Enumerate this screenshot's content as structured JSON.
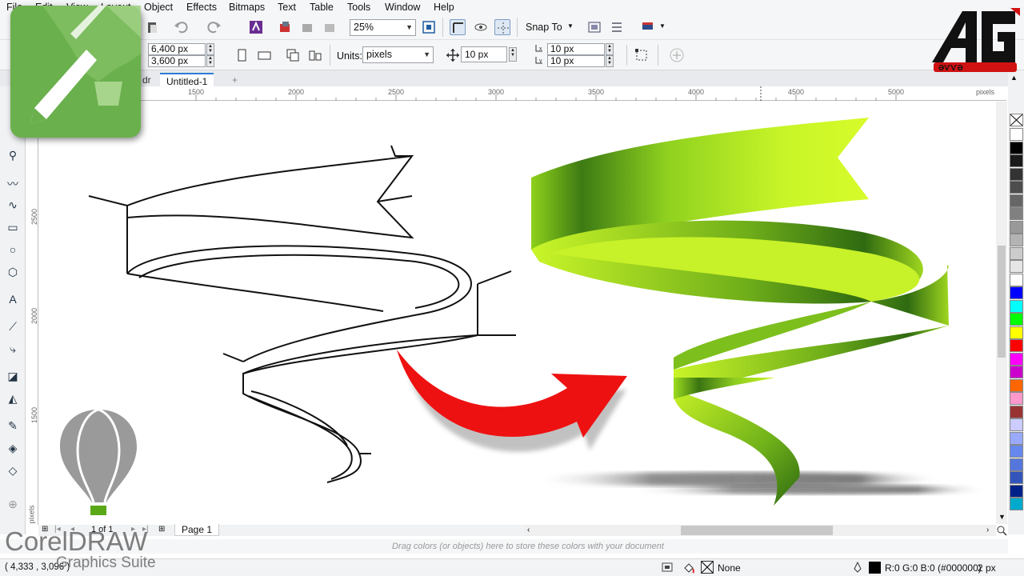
{
  "menu": [
    "File",
    "Edit",
    "View",
    "Layout",
    "Object",
    "Effects",
    "Bitmaps",
    "Text",
    "Table",
    "Tools",
    "Window",
    "Help"
  ],
  "toolbar": {
    "zoom": "25%",
    "snap_to": "Snap To"
  },
  "property_bar": {
    "width": "6,400 px",
    "height": "3,600 px",
    "units_label": "Units:",
    "units_value": "pixels",
    "nudge": "10 px",
    "dup_x": "10 px",
    "dup_y": "10 px"
  },
  "tabs": [
    {
      "label": "dr"
    },
    {
      "label": "Untitled-1"
    }
  ],
  "rulers": {
    "h_labels": [
      "1500",
      "2000",
      "2500",
      "3000",
      "3500",
      "4000",
      "4500",
      "5000"
    ],
    "h_unit": "pixels",
    "v_labels": [
      "2500",
      "2000",
      "1500"
    ],
    "v_unit": "pixels"
  },
  "page_nav": {
    "count": "1 of 1",
    "page_tab": "Page 1"
  },
  "color_doc_hint": "Drag colors (or objects) here to store these colors with your document",
  "status": {
    "coords": "( 4,333 , 3,096 )",
    "fill": "None",
    "outline_color": "R:0 G:0 B:0 (#000000)",
    "outline_width": "2 px"
  },
  "overlay": {
    "brand_line1": "CorelDRAW",
    "brand_line2": "Graphics Suite"
  },
  "palette_colors": [
    "#ffffff",
    "#000000",
    "#1a1a1a",
    "#333333",
    "#4d4d4d",
    "#666666",
    "#808080",
    "#999999",
    "#b3b3b3",
    "#cccccc",
    "#e6e6e6",
    "#ffffff",
    "#0000ff",
    "#00ffff",
    "#00ff00",
    "#ffff00",
    "#ff0000",
    "#ff00ff",
    "#cc00cc",
    "#ff6600",
    "#ff99cc",
    "#993333",
    "#ccccff",
    "#99aaff",
    "#6688ee",
    "#5577dd",
    "#3355bb",
    "#002288",
    "#00aacc"
  ]
}
